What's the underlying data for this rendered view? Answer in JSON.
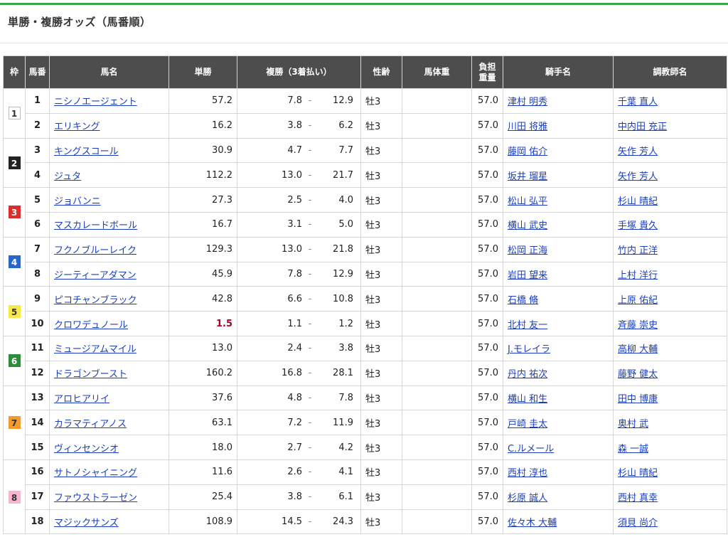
{
  "page": {
    "title": "単勝・複勝オッズ（馬番順）"
  },
  "headers": {
    "waku": "枠",
    "umaban": "馬番",
    "horse": "馬名",
    "win": "単勝",
    "place": "複勝（3着払い）",
    "sexage": "性齢",
    "bodyweight": "馬体重",
    "weight_line1": "負担",
    "weight_line2": "重量",
    "jockey": "騎手名",
    "trainer": "調教師名"
  },
  "waku_colors": {
    "1": {
      "bg": "#ffffff",
      "fg": "#333333",
      "border": "#bbbbbb"
    },
    "2": {
      "bg": "#222222",
      "fg": "#ffffff",
      "border": "#222222"
    },
    "3": {
      "bg": "#d92e2e",
      "fg": "#ffffff",
      "border": "#d92e2e"
    },
    "4": {
      "bg": "#2a66c9",
      "fg": "#ffffff",
      "border": "#2a66c9"
    },
    "5": {
      "bg": "#f7e94a",
      "fg": "#333333",
      "border": "#f7e94a"
    },
    "6": {
      "bg": "#2f8a3c",
      "fg": "#ffffff",
      "border": "#2f8a3c"
    },
    "7": {
      "bg": "#f29a2e",
      "fg": "#333333",
      "border": "#f29a2e"
    },
    "8": {
      "bg": "#f6b6cf",
      "fg": "#333333",
      "border": "#f6b6cf"
    }
  },
  "rows": [
    {
      "waku": "1",
      "umaban": "1",
      "horse": "ニシノエージェント",
      "win": "57.2",
      "place_min": "7.8",
      "place_max": "12.9",
      "sexage": "牡3",
      "bodyweight": "",
      "weight": "57.0",
      "jockey": "津村 明秀",
      "trainer": "千葉 直人"
    },
    {
      "waku": "1",
      "umaban": "2",
      "horse": "エリキング",
      "win": "16.2",
      "place_min": "3.8",
      "place_max": "6.2",
      "sexage": "牡3",
      "bodyweight": "",
      "weight": "57.0",
      "jockey": "川田 将雅",
      "trainer": "中内田 充正"
    },
    {
      "waku": "2",
      "umaban": "3",
      "horse": "キングスコール",
      "win": "30.9",
      "place_min": "4.7",
      "place_max": "7.7",
      "sexage": "牡3",
      "bodyweight": "",
      "weight": "57.0",
      "jockey": "藤岡 佑介",
      "trainer": "矢作 芳人"
    },
    {
      "waku": "2",
      "umaban": "4",
      "horse": "ジュタ",
      "win": "112.2",
      "place_min": "13.0",
      "place_max": "21.7",
      "sexage": "牡3",
      "bodyweight": "",
      "weight": "57.0",
      "jockey": "坂井 瑠星",
      "trainer": "矢作 芳人"
    },
    {
      "waku": "3",
      "umaban": "5",
      "horse": "ジョバンニ",
      "win": "27.3",
      "place_min": "2.5",
      "place_max": "4.0",
      "sexage": "牡3",
      "bodyweight": "",
      "weight": "57.0",
      "jockey": "松山 弘平",
      "trainer": "杉山 晴紀"
    },
    {
      "waku": "3",
      "umaban": "6",
      "horse": "マスカレードボール",
      "win": "16.7",
      "place_min": "3.1",
      "place_max": "5.0",
      "sexage": "牡3",
      "bodyweight": "",
      "weight": "57.0",
      "jockey": "横山 武史",
      "trainer": "手塚 貴久"
    },
    {
      "waku": "4",
      "umaban": "7",
      "horse": "フクノブルーレイク",
      "win": "129.3",
      "place_min": "13.0",
      "place_max": "21.8",
      "sexage": "牡3",
      "bodyweight": "",
      "weight": "57.0",
      "jockey": "松岡 正海",
      "trainer": "竹内 正洋"
    },
    {
      "waku": "4",
      "umaban": "8",
      "horse": "ジーティーアダマン",
      "win": "45.9",
      "place_min": "7.8",
      "place_max": "12.9",
      "sexage": "牡3",
      "bodyweight": "",
      "weight": "57.0",
      "jockey": "岩田 望来",
      "trainer": "上村 洋行"
    },
    {
      "waku": "5",
      "umaban": "9",
      "horse": "ピコチャンブラック",
      "win": "42.8",
      "place_min": "6.6",
      "place_max": "10.8",
      "sexage": "牡3",
      "bodyweight": "",
      "weight": "57.0",
      "jockey": "石橋 脩",
      "trainer": "上原 佑紀"
    },
    {
      "waku": "5",
      "umaban": "10",
      "horse": "クロワデュノール",
      "win": "1.5",
      "place_min": "1.1",
      "place_max": "1.2",
      "sexage": "牡3",
      "bodyweight": "",
      "weight": "57.0",
      "jockey": "北村 友一",
      "trainer": "斉藤 崇史",
      "favorite": true
    },
    {
      "waku": "6",
      "umaban": "11",
      "horse": "ミュージアムマイル",
      "win": "13.0",
      "place_min": "2.4",
      "place_max": "3.8",
      "sexage": "牡3",
      "bodyweight": "",
      "weight": "57.0",
      "jockey": "J.モレイラ",
      "trainer": "高柳 大輔"
    },
    {
      "waku": "6",
      "umaban": "12",
      "horse": "ドラゴンブースト",
      "win": "160.2",
      "place_min": "16.8",
      "place_max": "28.1",
      "sexage": "牡3",
      "bodyweight": "",
      "weight": "57.0",
      "jockey": "丹内 祐次",
      "trainer": "藤野 健太"
    },
    {
      "waku": "7",
      "umaban": "13",
      "horse": "アロヒアリイ",
      "win": "37.6",
      "place_min": "4.8",
      "place_max": "7.8",
      "sexage": "牡3",
      "bodyweight": "",
      "weight": "57.0",
      "jockey": "横山 和生",
      "trainer": "田中 博康"
    },
    {
      "waku": "7",
      "umaban": "14",
      "horse": "カラマティアノス",
      "win": "63.1",
      "place_min": "7.2",
      "place_max": "11.9",
      "sexage": "牡3",
      "bodyweight": "",
      "weight": "57.0",
      "jockey": "戸崎 圭太",
      "trainer": "奥村 武"
    },
    {
      "waku": "7",
      "umaban": "15",
      "horse": "ヴィンセンシオ",
      "win": "18.0",
      "place_min": "2.7",
      "place_max": "4.2",
      "sexage": "牡3",
      "bodyweight": "",
      "weight": "57.0",
      "jockey": "C.ルメール",
      "trainer": "森 一誠"
    },
    {
      "waku": "8",
      "umaban": "16",
      "horse": "サトノシャイニング",
      "win": "11.6",
      "place_min": "2.6",
      "place_max": "4.1",
      "sexage": "牡3",
      "bodyweight": "",
      "weight": "57.0",
      "jockey": "西村 淳也",
      "trainer": "杉山 晴紀"
    },
    {
      "waku": "8",
      "umaban": "17",
      "horse": "ファウストラーゼン",
      "win": "25.4",
      "place_min": "3.8",
      "place_max": "6.1",
      "sexage": "牡3",
      "bodyweight": "",
      "weight": "57.0",
      "jockey": "杉原 誠人",
      "trainer": "西村 真幸"
    },
    {
      "waku": "8",
      "umaban": "18",
      "horse": "マジックサンズ",
      "win": "108.9",
      "place_min": "14.5",
      "place_max": "24.3",
      "sexage": "牡3",
      "bodyweight": "",
      "weight": "57.0",
      "jockey": "佐々木 大輔",
      "trainer": "須貝 尚介"
    }
  ]
}
